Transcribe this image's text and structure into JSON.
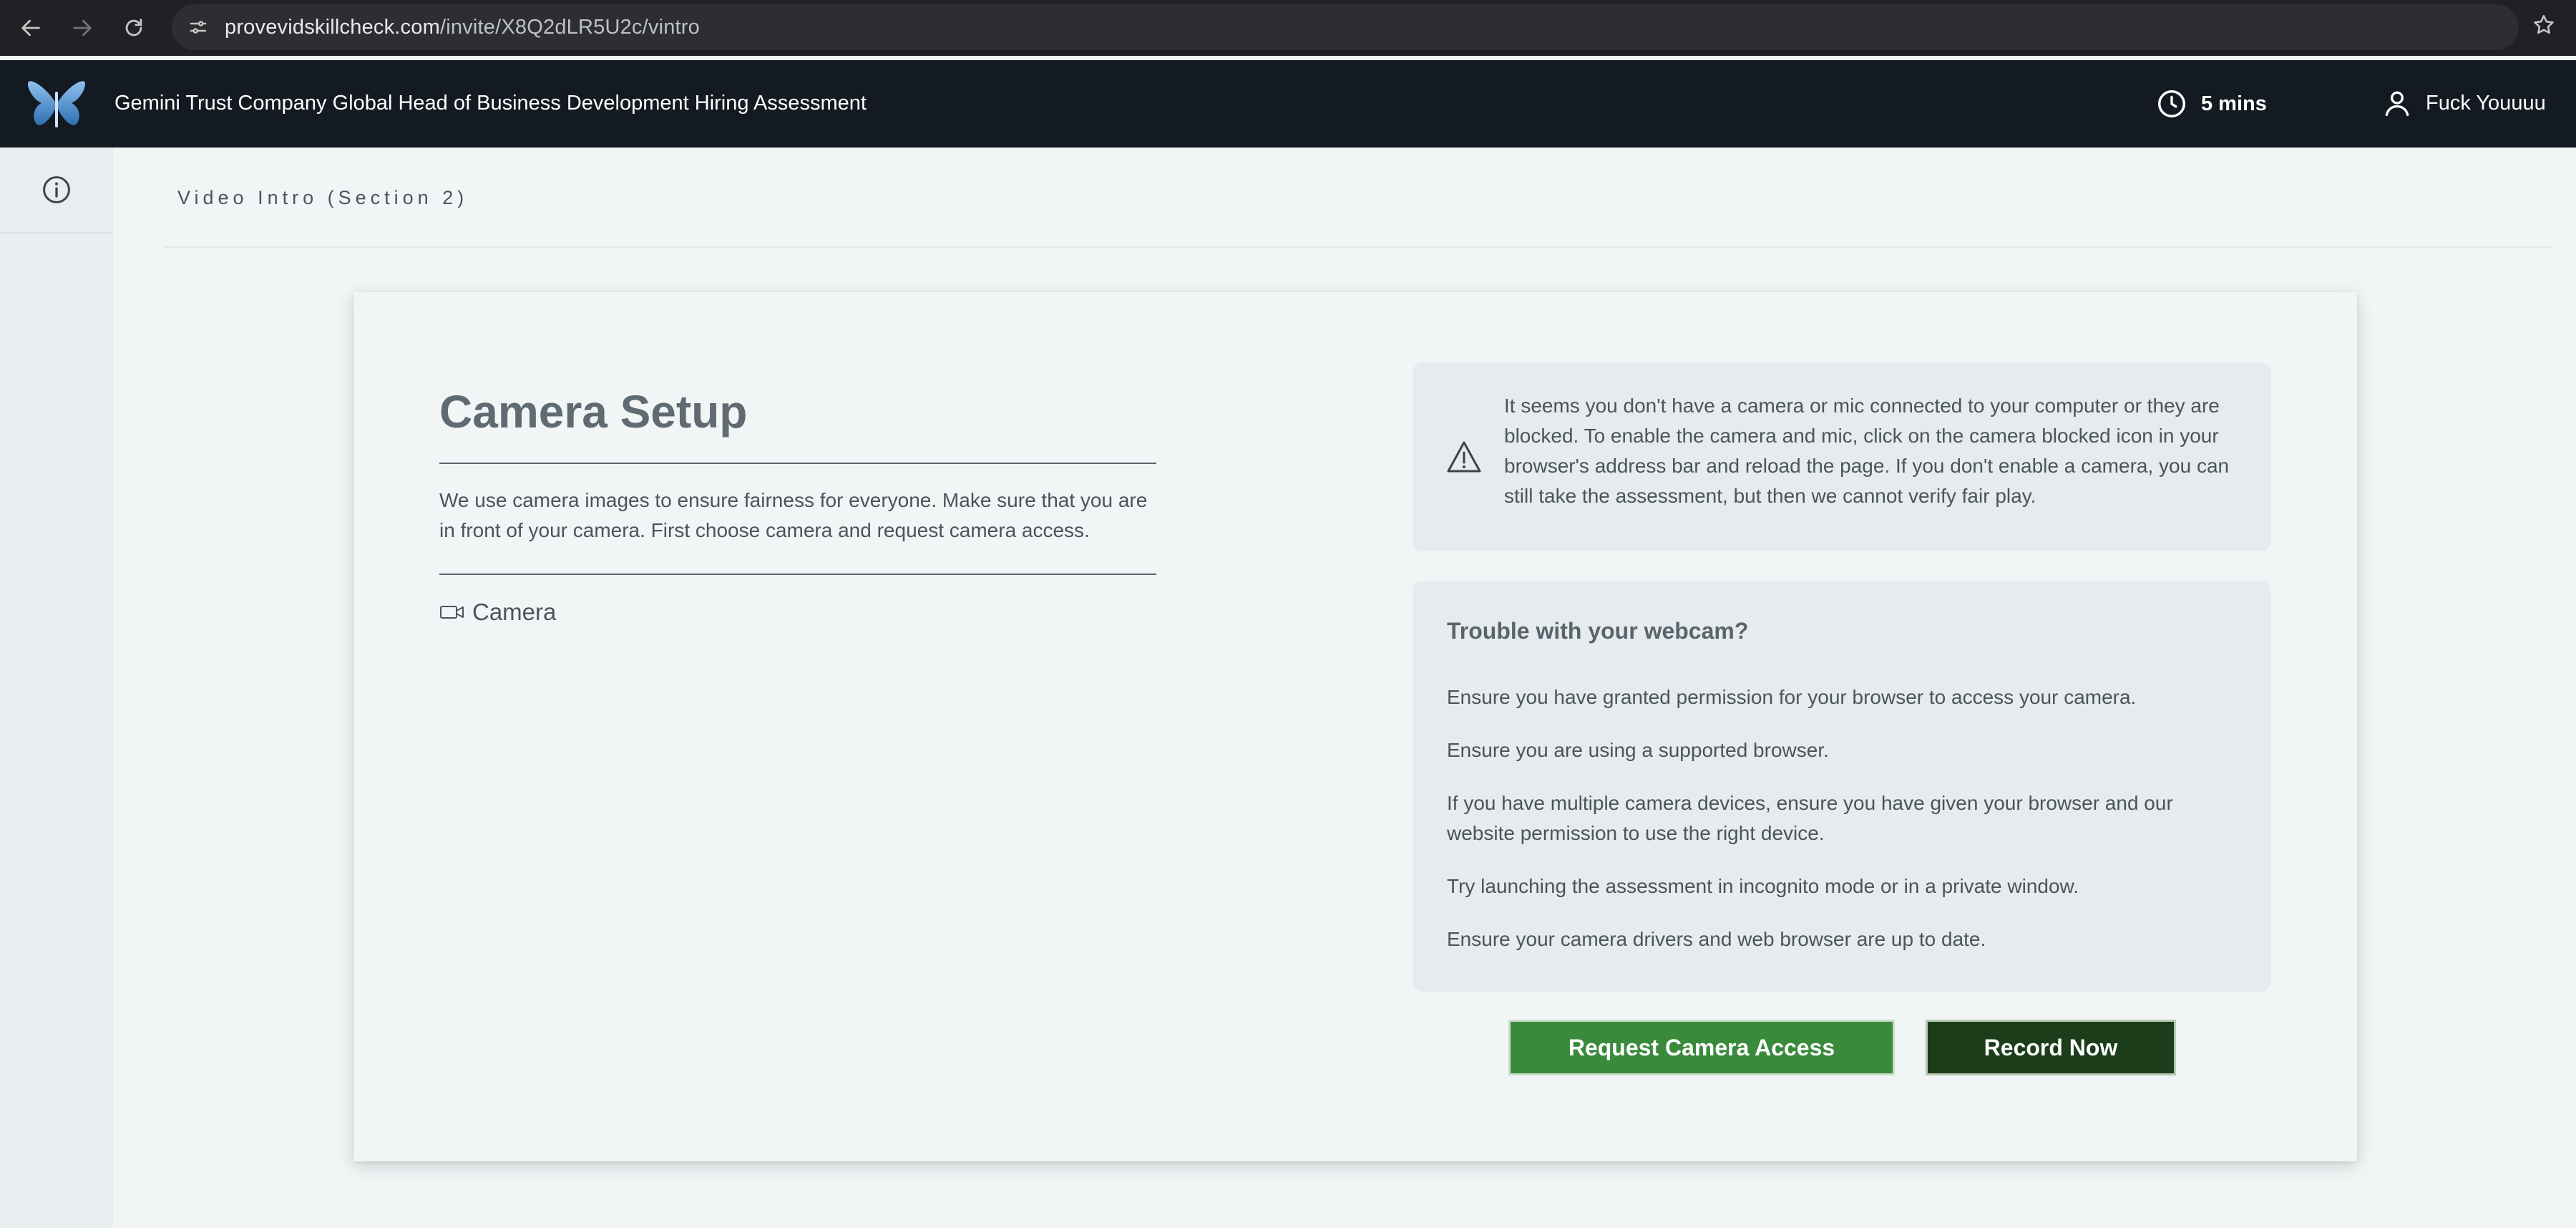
{
  "browser": {
    "url_host": "provevidskillcheck.com",
    "url_path": "/invite/X8Q2dLR5U2c/vintro"
  },
  "header": {
    "assessment_title": "Gemini Trust Company Global Head of Business Development Hiring Assessment",
    "timer": "5 mins",
    "user_name": "Fuck Youuuu"
  },
  "section": {
    "title": "Video Intro (Section 2)"
  },
  "setup": {
    "title": "Camera Setup",
    "description": "We use camera images to ensure fairness for everyone. Make sure that you are in front of your camera. First choose camera and request camera access.",
    "camera_label": "Camera"
  },
  "warning": {
    "text": "It seems you don't have a camera or mic connected to your computer or they are blocked. To enable the camera and mic, click on the camera blocked icon in your browser's address bar and reload the page. If you don't enable a camera, you can still take the assessment, but then we cannot verify fair play."
  },
  "trouble": {
    "title": "Trouble with your webcam?",
    "items": [
      "Ensure you have granted permission for your browser to access your camera.",
      "Ensure you are using a supported browser.",
      "If you have multiple camera devices, ensure you have given your browser and our website permission to use the right device.",
      "Try launching the assessment in incognito mode or in a private window.",
      "Ensure your camera drivers and web browser are up to date."
    ]
  },
  "buttons": {
    "request_access": "Request Camera Access",
    "record_now": "Record Now"
  },
  "colors": {
    "request_button": "#3a8a3c",
    "record_button": "#1c3d1a",
    "header_bg": "#131a22",
    "logo_blue": "#5b9bd5"
  },
  "icons": {
    "back": "arrow-left-icon",
    "forward": "arrow-right-icon",
    "reload": "reload-icon",
    "site_info": "tune-icon",
    "bookmark": "star-icon",
    "logo": "butterfly-logo",
    "timer": "clock-icon",
    "user": "user-icon",
    "info": "info-icon",
    "camera": "video-camera-icon",
    "warning": "warning-triangle-icon"
  }
}
